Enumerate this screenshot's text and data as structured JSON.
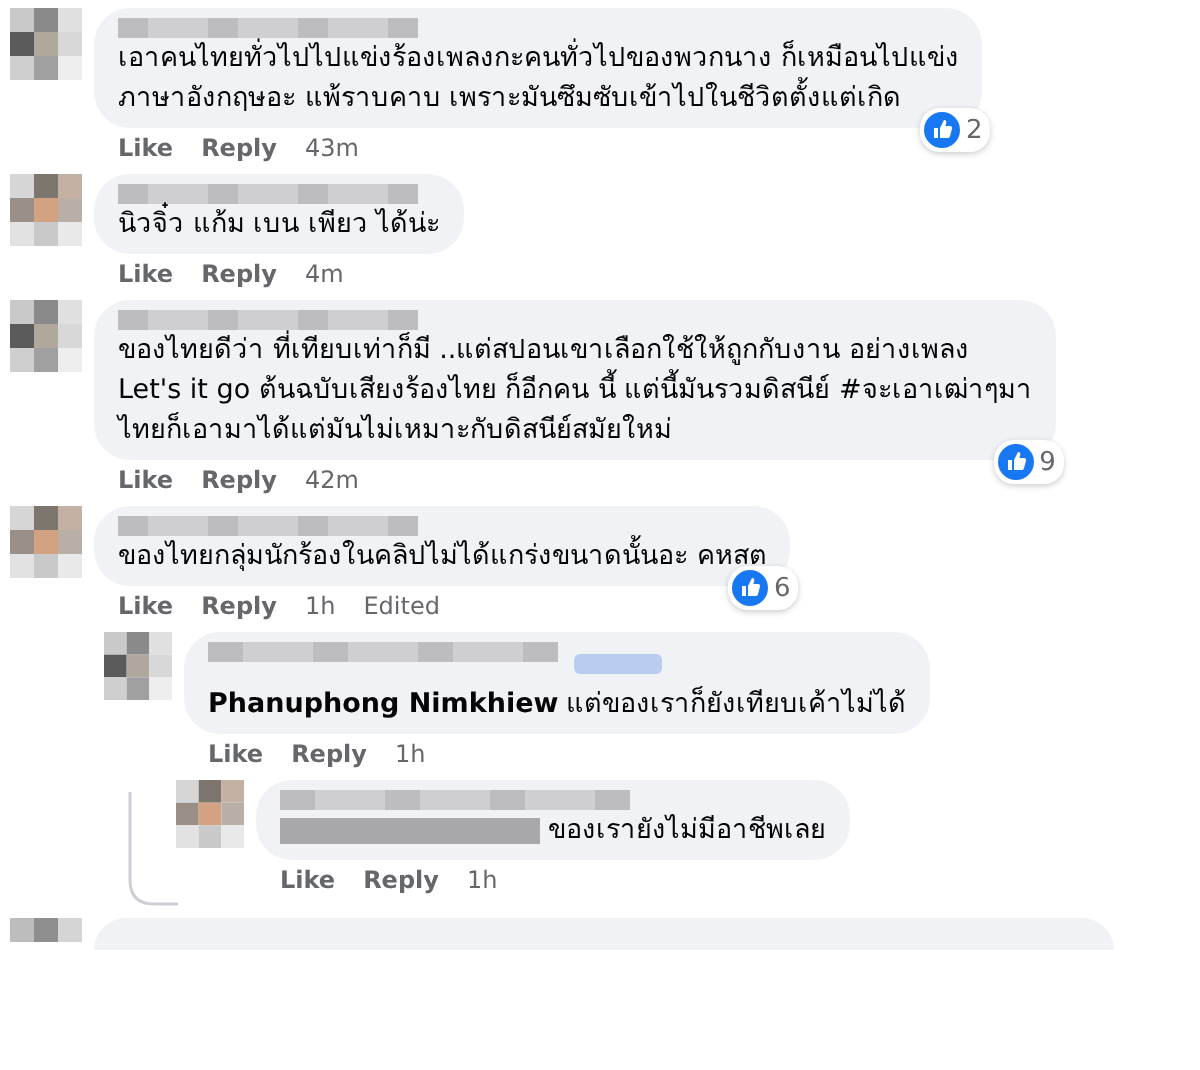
{
  "comments": [
    {
      "lines": [
        "เอาคนไทยทั่วไปไปแข่งร้องเพลงกะคนทั่วไปของพวกนาง ก็เหมือนไปแข่ง",
        "ภาษาอังกฤษอะ แพ้ราบคาบ เพราะมันซึมซับเข้าไปในชีวิตตั้งแต่เกิด"
      ],
      "like": "Like",
      "reply": "Reply",
      "time": "43m",
      "reactions": "2"
    },
    {
      "lines": [
        "นิวจิ๋ว แก้ม เบน เพียว ได้น่ะ"
      ],
      "like": "Like",
      "reply": "Reply",
      "time": "4m"
    },
    {
      "lines": [
        "ของไทยดีว่า ที่เทียบเท่าก็มี ..แต่สปอนเขาเลือกใช้ให้ถูกกับงาน อย่างเพลง",
        "Let's it go ต้นฉบับเสียงร้องไทย ก็อีกคน นี้ แต่นี้มันรวมดิสนีย์ #จะเอาเฒ่าๆมา",
        "ไทยก็เอามาได้แต่มันไม่เหมาะกับดิสนีย์สมัยใหม่"
      ],
      "like": "Like",
      "reply": "Reply",
      "time": "42m",
      "reactions": "9"
    },
    {
      "lines": [
        "ของไทยกลุ่มนักร้องในคลิปไม่ได้แกร่งขนาดนั้นอะ คหสต"
      ],
      "like": "Like",
      "reply": "Reply",
      "time": "1h",
      "edited": "Edited",
      "reactions": "6",
      "replies": [
        {
          "mention": "Phanuphong Nimkhiew",
          "lines": [
            "แต่ของเราก็ยังเทียบเค้าไม่ได้"
          ],
          "like": "Like",
          "reply": "Reply",
          "time": "1h"
        },
        {
          "mention_hidden": true,
          "lines": [
            "ของเรายังไม่มีอาชีพเลย"
          ],
          "like": "Like",
          "reply": "Reply",
          "time": "1h"
        }
      ]
    }
  ],
  "more_below": true
}
